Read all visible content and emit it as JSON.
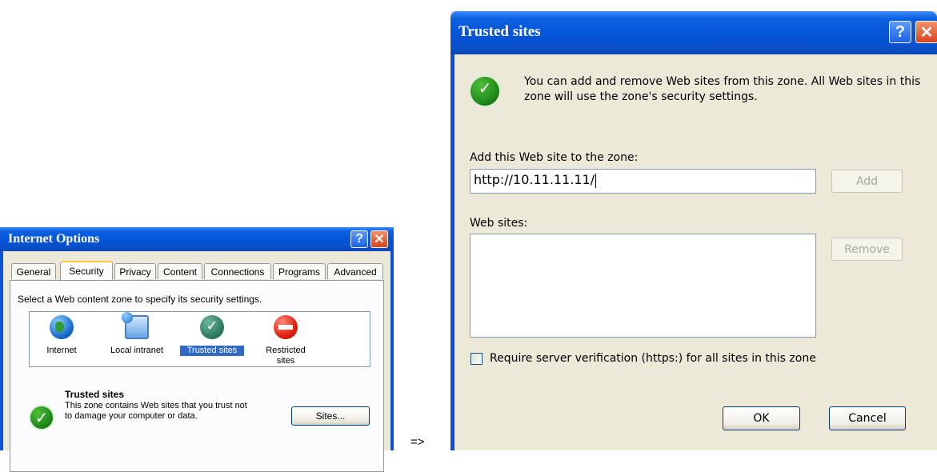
{
  "internet_options": {
    "title": "Internet Options",
    "tabs": [
      "General",
      "Security",
      "Privacy",
      "Content",
      "Connections",
      "Programs",
      "Advanced"
    ],
    "active_tab": "Security",
    "instruction": "Select a Web content zone to specify its security settings.",
    "zones": [
      {
        "label": "Internet",
        "icon": "globe-icon"
      },
      {
        "label": "Local intranet",
        "icon": "intranet-icon"
      },
      {
        "label": "Trusted sites",
        "icon": "trusted-sites-icon",
        "selected": true
      },
      {
        "label": "Restricted sites",
        "icon": "restricted-icon"
      }
    ],
    "zone_heading": "Trusted sites",
    "zone_description": "This zone contains Web sites that you trust not to damage your computer or data.",
    "sites_button": "Sites..."
  },
  "arrow": "=>",
  "trusted_sites_dialog": {
    "title": "Trusted sites",
    "info_text": "You can add and remove Web sites from this zone. All Web sites in this zone will use the zone's security settings.",
    "add_label": "Add this Web site to the zone:",
    "add_input_value": "http://10.11.11.11/",
    "add_button": "Add",
    "websites_label": "Web sites:",
    "websites": [],
    "remove_button": "Remove",
    "require_https_label": "Require server verification (https:) for all sites in this zone",
    "require_https_checked": false,
    "ok_button": "OK",
    "cancel_button": "Cancel"
  },
  "colors": {
    "titlebar": "#0554d8",
    "window_bg": "#ece9d8",
    "selection": "#316ac5",
    "active_tab_accent": "#ffc83c"
  }
}
